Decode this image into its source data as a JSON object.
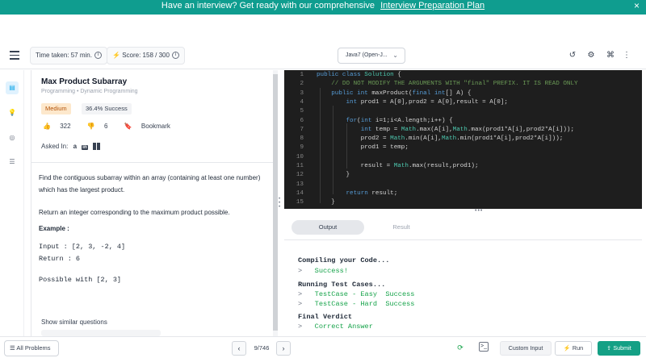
{
  "banner": {
    "text": "Have an interview? Get ready with our comprehensive",
    "link": "Interview Preparation Plan",
    "close": "×"
  },
  "topbar": {
    "time_taken": "Time taken: 57 min.",
    "score": "Score: 158 / 300",
    "language": "Java7 (Open-J..."
  },
  "problem": {
    "title": "Max Product Subarray",
    "breadcrumb": "Programming • Dynamic Programming",
    "difficulty": "Medium",
    "success_rate": "36.4% Success",
    "likes": "322",
    "dislikes": "6",
    "bookmark": "Bookmark",
    "asked_in": "Asked In:",
    "companies": [
      "a",
      "in",
      ""
    ],
    "description": [
      "Find the contiguous subarray within an array (containing at least one number) which has the largest product.",
      "Return an integer corresponding to the maximum product possible."
    ],
    "example_label": "Example :",
    "example_io": "Input : [2, 3, -2, 4]\nReturn : 6",
    "example_note": "Possible with [2, 3]",
    "show_similar": "Show similar questions"
  },
  "editor": {
    "lines": [
      "public class Solution {",
      "    // DO NOT MODIFY THE ARGUMENTS WITH \"final\" PREFIX. IT IS READ ONLY",
      "    public int maxProduct(final int[] A) {",
      "        int prod1 = A[0],prod2 = A[0],result = A[0];",
      "",
      "        for(int i=1;i<A.length;i++) {",
      "            int temp = Math.max(A[i],Math.max(prod1*A[i],prod2*A[i]));",
      "            prod2 = Math.min(A[i],Math.min(prod1*A[i],prod2*A[i]));",
      "            prod1 = temp;",
      "",
      "            result = Math.max(result,prod1);",
      "        }",
      "",
      "        return result;",
      "    }"
    ]
  },
  "output": {
    "tab_output": "Output",
    "tab_result": "Result",
    "compiling": "Compiling your Code...",
    "compile_status": "Success!",
    "running": "Running Test Cases...",
    "test1": "TestCase - Easy  Success",
    "test2": "TestCase - Hard  Success",
    "verdict_label": "Final Verdict",
    "verdict": "Correct Answer",
    "prompt": ">"
  },
  "footer": {
    "all_problems": "All Problems",
    "page": "9/746",
    "custom_input": "Custom Input",
    "run": "Run",
    "submit": "Submit"
  }
}
